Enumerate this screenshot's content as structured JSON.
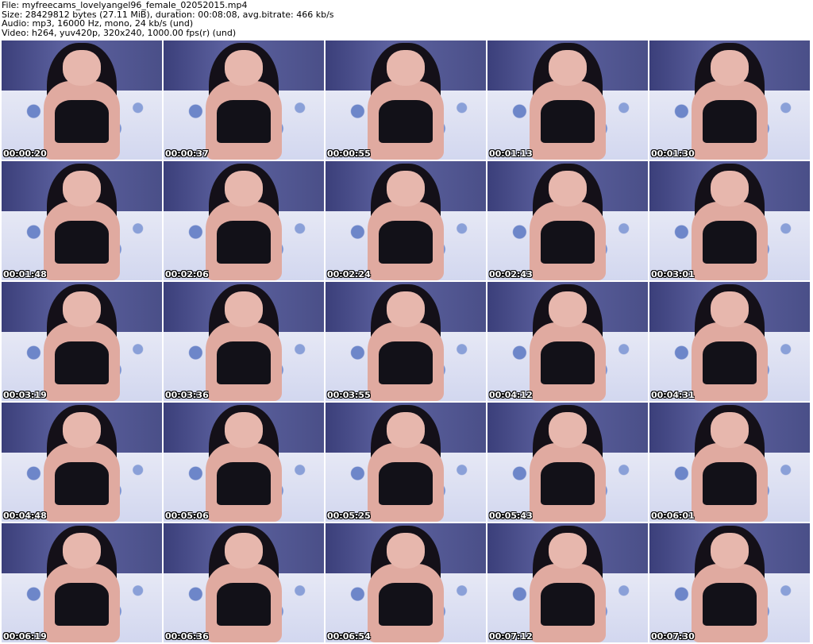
{
  "header": {
    "file_line": "File: myfreecams_lovelyangel96_female_02052015.mp4",
    "size_line": "Size: 28429812 bytes (27.11 MiB), duration: 00:08:08, avg.bitrate: 466 kb/s",
    "audio_line": "Audio: mp3, 16000 Hz, mono, 24 kb/s (und)",
    "video_line": "Video: h264, yuv420p, 320x240, 1000.00 fps(r) (und)"
  },
  "thumbnails": [
    "00:00:20",
    "00:00:37",
    "00:00:55",
    "00:01:13",
    "00:01:30",
    "00:01:48",
    "00:02:06",
    "00:02:24",
    "00:02:43",
    "00:03:01",
    "00:03:19",
    "00:03:36",
    "00:03:55",
    "00:04:12",
    "00:04:31",
    "00:04:48",
    "00:05:06",
    "00:05:25",
    "00:05:43",
    "00:06:01",
    "00:06:19",
    "00:06:36",
    "00:06:54",
    "00:07:12",
    "00:07:30"
  ]
}
